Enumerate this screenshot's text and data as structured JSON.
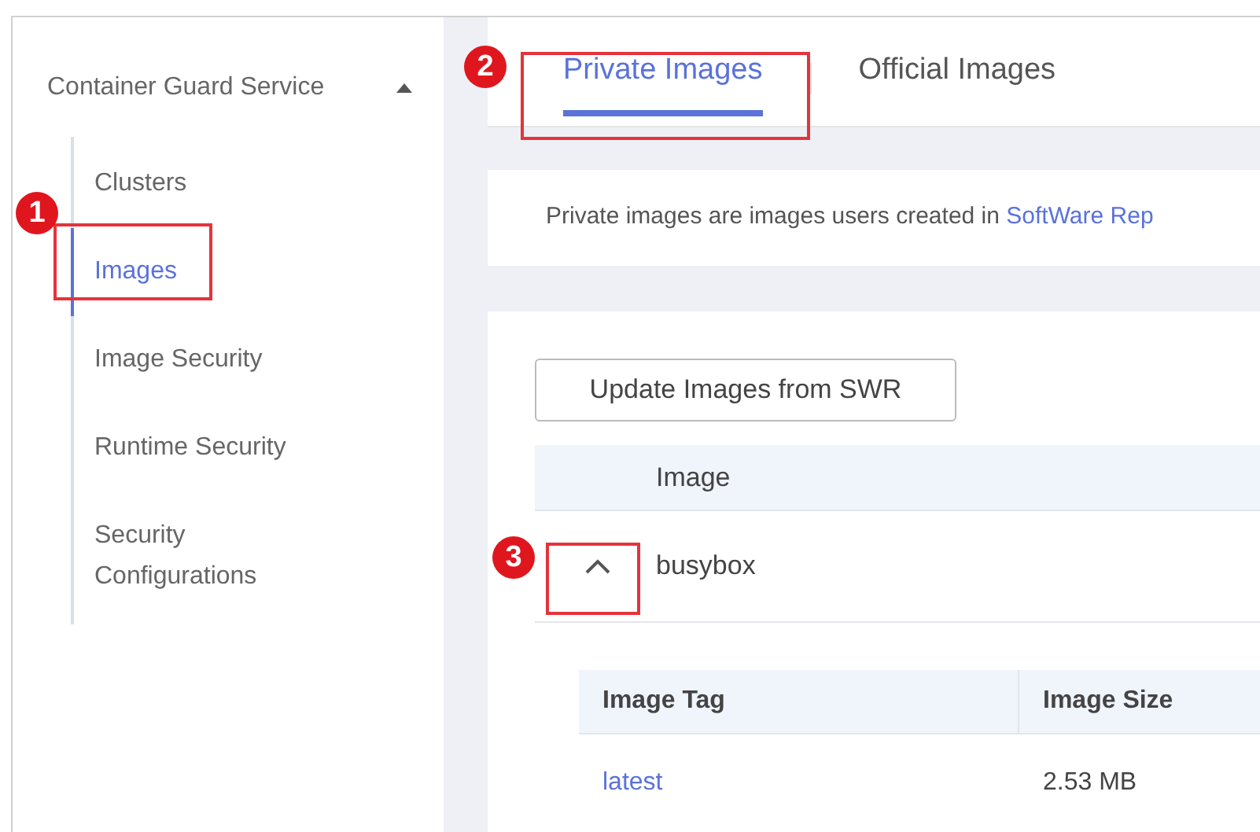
{
  "sidebar": {
    "title": "Container Guard Service",
    "expanded": true,
    "items": [
      {
        "label": "Clusters",
        "selected": false
      },
      {
        "label": "Images",
        "selected": true
      },
      {
        "label": "Image Security",
        "selected": false
      },
      {
        "label": "Runtime Security",
        "selected": false
      },
      {
        "label": "Security Configurations",
        "selected": false
      }
    ]
  },
  "tabs": [
    {
      "label": "Private Images",
      "selected": true
    },
    {
      "label": "Official Images",
      "selected": false
    }
  ],
  "info": {
    "text": "Private images are images users created in ",
    "link": "SoftWare Rep"
  },
  "update_button": "Update Images from SWR",
  "table": {
    "columns": [
      "Image"
    ],
    "rows": [
      {
        "name": "busybox",
        "expanded": true,
        "subtable": {
          "columns": [
            "Image Tag",
            "Image Size"
          ],
          "rows": [
            {
              "tag": "latest",
              "size": "2.53 MB"
            }
          ]
        }
      }
    ]
  },
  "callouts": [
    {
      "number": "1"
    },
    {
      "number": "2"
    },
    {
      "number": "3"
    }
  ]
}
